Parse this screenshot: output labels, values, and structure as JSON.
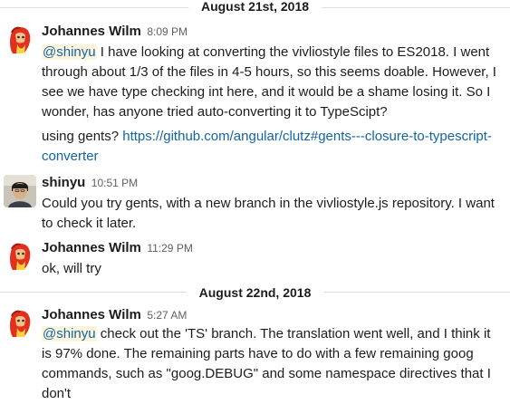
{
  "days": [
    {
      "label": "August 21st, 2018"
    },
    {
      "label": "August 22nd, 2018"
    }
  ],
  "messages": [
    {
      "sender": "Johannes Wilm",
      "time": "8:09 PM",
      "paragraphs": [
        {
          "mention": "@shinyu",
          "text": " I have looking at converting the vivliostyle files to ES2018. I went through about 1/3 of the files in 4-5 hours, so this seems doable. However, I see we have type checking int here, and it would be a shame losing it. So I wonder, has anyone tried auto-converting it to TypeScipt?"
        },
        {
          "text": "using gents? ",
          "link": "https://github.com/angular/clutz#gents---closure-to-typescript-converter"
        }
      ]
    },
    {
      "sender": "shinyu",
      "time": "10:51 PM",
      "paragraphs": [
        {
          "text": "Could you try gents, with a new branch in the vivliostyle.js repository. I want to check it later."
        }
      ]
    },
    {
      "sender": "Johannes Wilm",
      "time": "11:29 PM",
      "paragraphs": [
        {
          "text": "ok, will try"
        }
      ]
    },
    {
      "sender": "Johannes Wilm",
      "time": "5:27 AM",
      "paragraphs": [
        {
          "mention": "@shinyu",
          "text": " check out the 'TS' branch. The translation went well, and I think it is 97% done. The remaining parts have to do with a few remaining goog commands, such as \"goog.DEBUG\" and some namespace directives that I don't"
        }
      ]
    }
  ],
  "colors": {
    "link": "#1264a3",
    "mention_bg": "#fdf4dc",
    "timestamp": "#616061",
    "divider": "#dddddd"
  },
  "icons": {
    "johannes_avatar": "red-illustrated-avatar",
    "shinyu_avatar": "photo-avatar"
  }
}
